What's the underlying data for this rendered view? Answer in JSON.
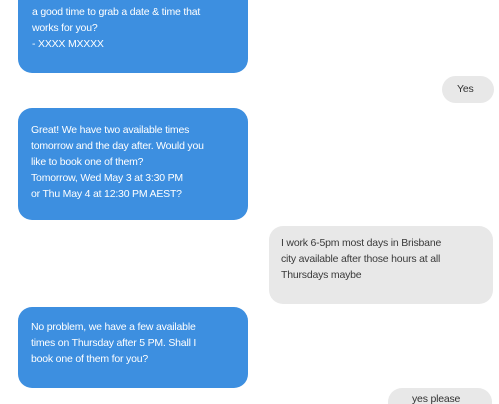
{
  "colors": {
    "incoming_bubble": "#3d8fe0",
    "outgoing_bubble": "#e8e8e8",
    "background": "#ffffff"
  },
  "messages": [
    {
      "direction": "incoming",
      "lines": [
        "a good time to grab a date & time that",
        "works for you?",
        "- XXXX MXXXX"
      ]
    },
    {
      "direction": "outgoing",
      "lines": [
        "Yes"
      ]
    },
    {
      "direction": "incoming",
      "lines": [
        "Great! We have two available times",
        "tomorrow and the day after. Would you",
        "like to book one of them?",
        "Tomorrow, Wed May 3 at 3:30 PM",
        "or Thu May 4 at 12:30 PM AEST?"
      ]
    },
    {
      "direction": "outgoing",
      "lines": [
        "I work 6-5pm most days in Brisbane",
        "city available after those hours at all",
        "Thursdays maybe"
      ]
    },
    {
      "direction": "incoming",
      "lines": [
        "No problem, we have a few available",
        "times on Thursday after 5 PM. Shall I",
        "book one of them for you?"
      ]
    },
    {
      "direction": "outgoing",
      "lines": [
        "yes please"
      ]
    }
  ]
}
